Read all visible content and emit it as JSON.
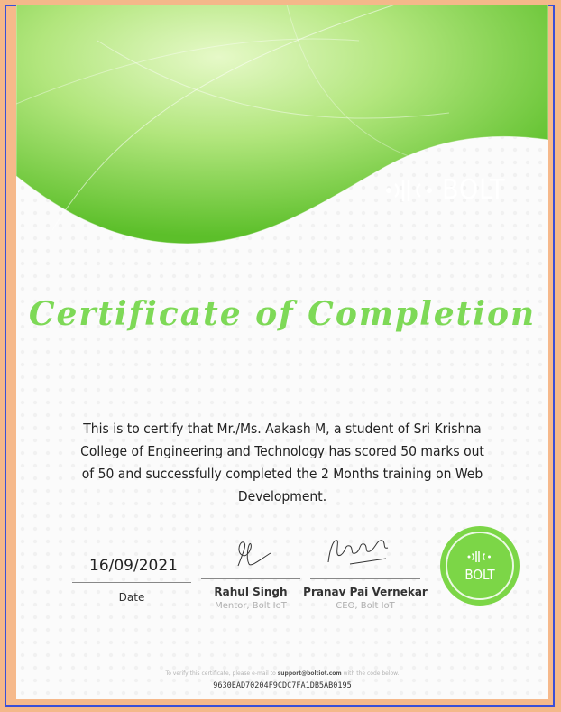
{
  "brand": {
    "name": "BOLT",
    "seal_text": "BOLT",
    "green_light": "#c9f29a",
    "green_dark": "#5cbf2a",
    "title_color": "#7ed957"
  },
  "certificate": {
    "title": "Certificate of Completion",
    "body": "This is to certify that Mr./Ms. Aakash M, a student of Sri Krishna College of Engineering and Technology has scored 50 marks out of 50 and successfully completed the 2 Months training on Web Development."
  },
  "date": {
    "value": "16/09/2021",
    "label": "Date"
  },
  "signatories": [
    {
      "name": "Rahul Singh",
      "role": "Mentor, Bolt IoT"
    },
    {
      "name": "Pranav Pai Vernekar",
      "role": "CEO, Bolt IoT"
    }
  ],
  "verification": {
    "prefix": "To verify this certificate, please e-mail to ",
    "email": "support@boltiot.com",
    "suffix": " with the code below.",
    "code": "9630EAD70204F9CDC7FA1DB5AB0195"
  }
}
